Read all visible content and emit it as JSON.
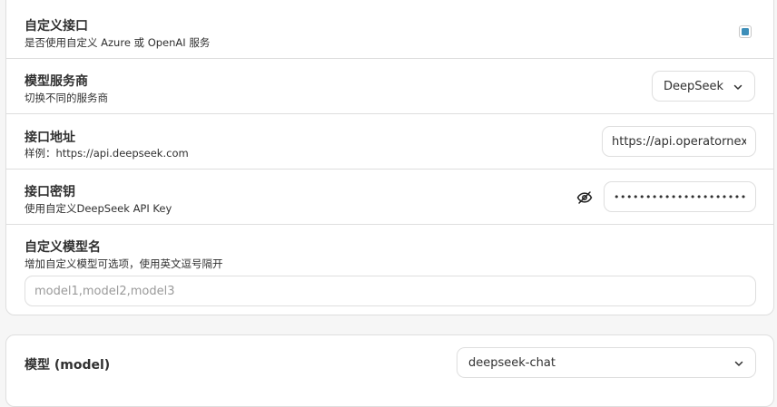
{
  "settings": {
    "custom_endpoint": {
      "title": "自定义接口",
      "subtitle": "是否使用自定义 Azure 或 OpenAI 服务",
      "checked": true
    },
    "provider": {
      "title": "模型服务商",
      "subtitle": "切换不同的服务商",
      "selected": "DeepSeek"
    },
    "endpoint": {
      "title": "接口地址",
      "subtitle": "样例：https://api.deepseek.com",
      "value": "https://api.operatornext"
    },
    "api_key": {
      "title": "接口密钥",
      "subtitle": "使用自定义DeepSeek API Key",
      "value": "••••••••••••••••••••••••••••••••"
    },
    "custom_models": {
      "title": "自定义模型名",
      "subtitle": "增加自定义模型可选项，使用英文逗号隔开",
      "placeholder": "model1,model2,model3"
    }
  },
  "model": {
    "title": "模型 (model)",
    "selected": "deepseek-chat"
  },
  "colors": {
    "accent": "#3d8eb9",
    "border": "#dedede",
    "background": "#f6f6f6"
  }
}
